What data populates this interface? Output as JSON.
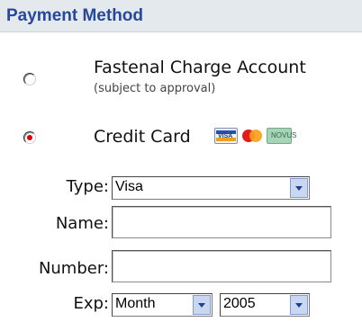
{
  "section": {
    "title": "Payment Method"
  },
  "options": {
    "charge_account": {
      "label": "Fastenal Charge Account",
      "sublabel": "(subject to approval)",
      "selected": false
    },
    "credit_card": {
      "label": "Credit Card",
      "selected": true,
      "card_icons": [
        "visa-card-icon",
        "mastercard-icon",
        "discover-card-icon"
      ]
    }
  },
  "card_icon_text": {
    "visa": "VISA",
    "discover": "NOVUS"
  },
  "form": {
    "type": {
      "label": "Type:",
      "value": "Visa"
    },
    "name": {
      "label": "Name:",
      "value": ""
    },
    "number": {
      "label": "Number:",
      "value": ""
    },
    "exp": {
      "label": "Exp:",
      "month": "Month",
      "year": "2005"
    }
  },
  "colors": {
    "header_bg": "#e4e9ee",
    "header_text": "#27489a",
    "radio_selected": "#e00000",
    "dropdown_button": "#c9d7f2"
  }
}
